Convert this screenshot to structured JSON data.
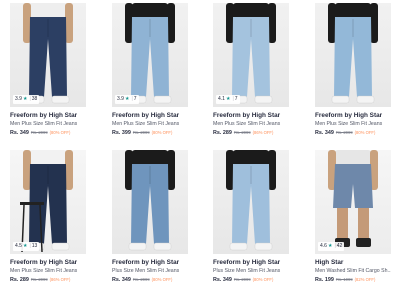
{
  "products": [
    {
      "brand": "Freeform by High Star",
      "title": "Men Plus Size Slim Fit Jeans",
      "price": "Rs. 349",
      "mrp": "Rs. 2099",
      "discount": "(80% OFF)",
      "rating": "3.9",
      "rating_count": "38",
      "jean_color": "#2c3f63",
      "top_color": "#eeeeee"
    },
    {
      "brand": "Freeform by High Star",
      "title": "Men Plus Size Slim Fit Jeans",
      "price": "Rs. 399",
      "mrp": "Rs. 2099",
      "discount": "(80% OFF)",
      "rating": "3.9",
      "rating_count": "7",
      "jean_color": "#8fb3d4",
      "top_color": "#1b1b1b"
    },
    {
      "brand": "Freeform by High Star",
      "title": "Men Plus Size Slim Fit Jeans",
      "price": "Rs. 289",
      "mrp": "Rs. 2099",
      "discount": "(86% OFF)",
      "rating": "4.1",
      "rating_count": "7",
      "jean_color": "#a4c3de",
      "top_color": "#1b1b1b"
    },
    {
      "brand": "Freeform by High Star",
      "title": "Men Plus Size Slim Fit Jeans",
      "price": "Rs. 349",
      "mrp": "Rs. 2099",
      "discount": "(80% OFF)",
      "rating": null,
      "rating_count": null,
      "jean_color": "#93b8d8",
      "top_color": "#1b1b1b"
    },
    {
      "brand": "Freeform by High Star",
      "title": "Men Plus Size Slim Fit Jeans",
      "price": "Rs. 289",
      "mrp": "Rs. 2099",
      "discount": "(86% OFF)",
      "rating": "4.5",
      "rating_count": "13",
      "jean_color": "#23324f",
      "top_color": "#f2f2f2"
    },
    {
      "brand": "Freeform by High Star",
      "title": "Plus Size Men Slim Fit Jeans",
      "price": "Rs. 349",
      "mrp": "Rs. 2099",
      "discount": "(80% OFF)",
      "rating": null,
      "rating_count": null,
      "jean_color": "#6f95bd",
      "top_color": "#1b1b1b"
    },
    {
      "brand": "Freeform by High Star",
      "title": "Plus Size Men Slim Fit Jeans",
      "price": "Rs. 349",
      "mrp": "Rs. 2099",
      "discount": "(80% OFF)",
      "rating": null,
      "rating_count": null,
      "jean_color": "#9fbfdc",
      "top_color": "#1b1b1b"
    },
    {
      "brand": "High Star",
      "title": "Men Washed Slim Fit Cargo Sh...",
      "price": "Rs. 199",
      "mrp": "Rs. 1099",
      "discount": "(82% OFF)",
      "rating": "4.6",
      "rating_count": "42",
      "jean_color": "#6e88aa",
      "top_color": "#e6e6e6",
      "shorts": true
    }
  ]
}
